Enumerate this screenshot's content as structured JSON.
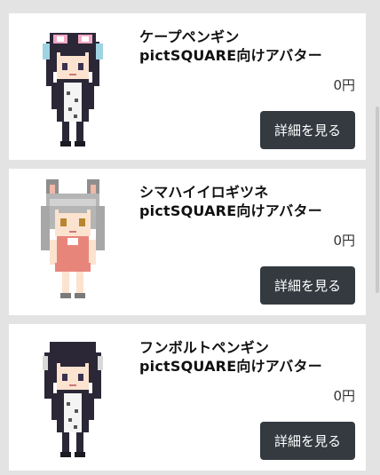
{
  "products": [
    {
      "title_line1": "ケープペンギン",
      "title_line2": "pictSQUARE向けアバター",
      "price": "0円",
      "button_label": "詳細を見る",
      "image_icon": "cape-penguin-avatar-icon"
    },
    {
      "title_line1": "シマハイイロギツネ",
      "title_line2": "pictSQUARE向けアバター",
      "price": "0円",
      "button_label": "詳細を見る",
      "image_icon": "island-fox-avatar-icon"
    },
    {
      "title_line1": "フンボルトペンギン",
      "title_line2": "pictSQUARE向けアバター",
      "price": "0円",
      "button_label": "詳細を見る",
      "image_icon": "humboldt-penguin-avatar-icon"
    }
  ]
}
